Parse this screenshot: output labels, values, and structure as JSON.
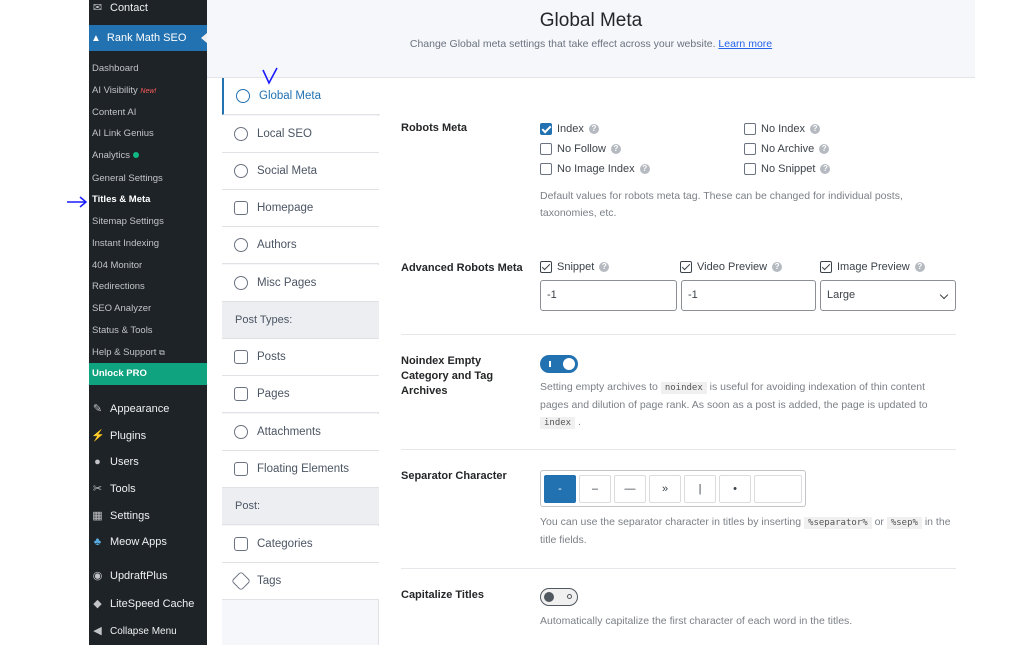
{
  "colors": {
    "accent": "#2271b1",
    "sidebar_bg": "#1d2327",
    "unlock_bg": "#10a37f",
    "annotation": "#1a1aff"
  },
  "wp_sidebar": {
    "contact": "Contact",
    "rank_math": "Rank Math SEO",
    "sub_items": [
      {
        "label": "Dashboard"
      },
      {
        "label": "AI Visibility",
        "badge": "New!"
      },
      {
        "label": "Content AI"
      },
      {
        "label": "AI Link Genius"
      },
      {
        "label": "Analytics"
      },
      {
        "label": "General Settings"
      },
      {
        "label": "Titles & Meta"
      },
      {
        "label": "Sitemap Settings"
      },
      {
        "label": "Instant Indexing"
      },
      {
        "label": "404 Monitor"
      },
      {
        "label": "Redirections"
      },
      {
        "label": "SEO Analyzer"
      },
      {
        "label": "Status & Tools"
      },
      {
        "label": "Help & Support"
      },
      {
        "label": "Unlock PRO"
      }
    ],
    "main_items": [
      {
        "label": "Appearance",
        "icon": "paintbrush-icon"
      },
      {
        "label": "Plugins",
        "icon": "plug-icon"
      },
      {
        "label": "Users",
        "icon": "user-icon"
      },
      {
        "label": "Tools",
        "icon": "wrench-icon"
      },
      {
        "label": "Settings",
        "icon": "sliders-icon"
      },
      {
        "label": "Meow Apps",
        "icon": "meow-icon"
      },
      {
        "label": "UpdraftPlus",
        "icon": "updraft-icon"
      },
      {
        "label": "LiteSpeed Cache",
        "icon": "diamond-icon"
      },
      {
        "label": "Collapse Menu",
        "icon": "collapse-icon"
      }
    ]
  },
  "header": {
    "title": "Global Meta",
    "subtitle": "Change Global meta settings that take effect across your website.",
    "learn_more": "Learn more"
  },
  "tabs": [
    {
      "label": "Global Meta",
      "icon": "gear-icon",
      "active": true
    },
    {
      "label": "Local SEO",
      "icon": "location-pin-icon"
    },
    {
      "label": "Social Meta",
      "icon": "share-icon"
    },
    {
      "label": "Homepage",
      "icon": "home-icon"
    },
    {
      "label": "Authors",
      "icon": "users-icon"
    },
    {
      "label": "Misc Pages",
      "icon": "list-icon"
    },
    {
      "label": "Post Types:",
      "group": true
    },
    {
      "label": "Posts",
      "icon": "document-icon"
    },
    {
      "label": "Pages",
      "icon": "pages-icon"
    },
    {
      "label": "Attachments",
      "icon": "paperclip-icon"
    },
    {
      "label": "Floating Elements",
      "icon": "document-icon"
    },
    {
      "label": "Post:",
      "group": true
    },
    {
      "label": "Categories",
      "icon": "folder-icon"
    },
    {
      "label": "Tags",
      "icon": "tag-icon"
    }
  ],
  "robots_meta": {
    "label": "Robots Meta",
    "options": [
      {
        "label": "Index",
        "checked": true
      },
      {
        "label": "No Index",
        "checked": false
      },
      {
        "label": "No Follow",
        "checked": false
      },
      {
        "label": "No Archive",
        "checked": false
      },
      {
        "label": "No Image Index",
        "checked": false
      },
      {
        "label": "No Snippet",
        "checked": false
      }
    ],
    "description": "Default values for robots meta tag. These can be changed for individual posts, taxonomies, etc."
  },
  "advanced_robots": {
    "label": "Advanced Robots Meta",
    "snippet": {
      "label": "Snippet",
      "value": "-1"
    },
    "video_preview": {
      "label": "Video Preview",
      "value": "-1"
    },
    "image_preview": {
      "label": "Image Preview",
      "value": "Large"
    }
  },
  "noindex_empty": {
    "label": "Noindex Empty Category and Tag Archives",
    "enabled": true,
    "desc_pre": "Setting empty archives to",
    "code1": "noindex",
    "desc_mid": "is useful for avoiding indexation of thin content pages and dilution of page rank. As soon as a post is added, the page is updated to",
    "code2": "index",
    "desc_end": "."
  },
  "separator": {
    "label": "Separator Character",
    "options": [
      "-",
      "–",
      "—",
      "»",
      "|",
      "•",
      ""
    ],
    "selected_index": 0,
    "desc_pre": "You can use the separator character in titles by inserting",
    "code1": "%separator%",
    "desc_or": "or",
    "code2": "%sep%",
    "desc_end": "in the title fields."
  },
  "capitalize": {
    "label": "Capitalize Titles",
    "enabled": false,
    "description": "Automatically capitalize the first character of each word in the titles."
  }
}
